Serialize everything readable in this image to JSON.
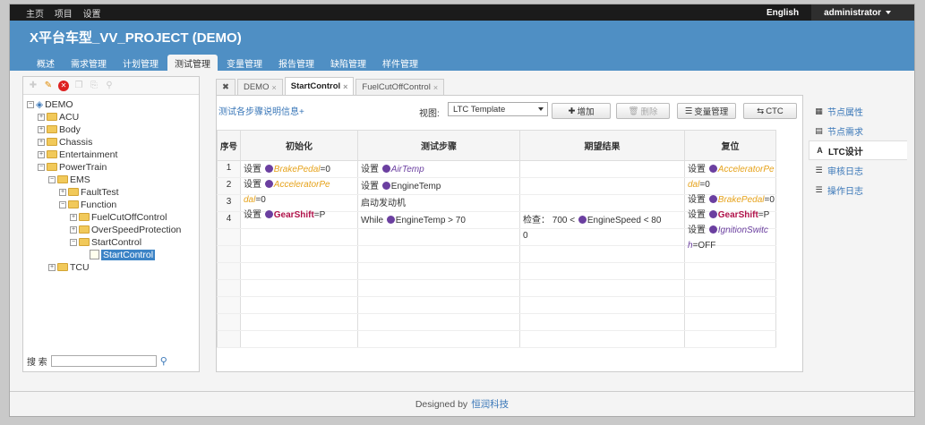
{
  "topbar": {
    "links": [
      "主页",
      "项目",
      "设置"
    ],
    "lang": "English",
    "user": "administrator"
  },
  "header": {
    "title": "X平台车型_VV_PROJECT (DEMO)"
  },
  "nav": [
    "概述",
    "需求管理",
    "计划管理",
    "测试管理",
    "变量管理",
    "报告管理",
    "缺陷管理",
    "样件管理"
  ],
  "nav_active": "测试管理",
  "tree": {
    "root": "DEMO",
    "nodes": [
      "ACU",
      "Body",
      "Chassis",
      "Entertainment",
      "PowerTrain",
      "EMS",
      "FaultTest",
      "Function",
      "FuelCutOffControl",
      "OverSpeedProtection",
      "StartControl",
      "StartControl",
      "TCU"
    ]
  },
  "search": {
    "label": "搜 索"
  },
  "tabs": [
    "DEMO",
    "StartControl",
    "FuelCutOffControl"
  ],
  "content": {
    "step_info_link": "测试各步骤说明信息+",
    "view_label": "视图:",
    "view_value": "LTC Template",
    "buttons": {
      "add": "增加",
      "delete": "删除",
      "var": "变量管理",
      "ctc": "CTC"
    }
  },
  "grid": {
    "headers": [
      "序号",
      "初始化",
      "测试步骤",
      "期望结果",
      "复位"
    ],
    "nums": [
      "1",
      "2",
      "3",
      "4"
    ],
    "init": {
      "set": "设置",
      "v1": "BrakePedal",
      "e1": "=0",
      "v2a": "AcceleratorPe",
      "v2b": "dal",
      "e2": "=0",
      "v3": "GearShift",
      "e3": "=P"
    },
    "steps": {
      "set": "设置",
      "s1": "AirTemp",
      "s2": "EngineTemp",
      "s3": "启动发动机",
      "s4a": "While ",
      "s4b": "EngineTemp > 70"
    },
    "expect": {
      "a": "检查： 700 < ",
      "b": "EngineSpeed < 80",
      "c": "0"
    },
    "reset": {
      "set": "设置",
      "v1a": "AcceleratorPe",
      "v1b": "dal",
      "e1": "=0",
      "v2": "BrakePedal",
      "e2": "=0",
      "v3": "GearShift",
      "e3": "=P",
      "v4a": "IgnitionSwitc",
      "v4b": "h",
      "e4": "=OFF"
    }
  },
  "right_menu": [
    "节点属性",
    "节点需求",
    "LTC设计",
    "审核日志",
    "操作日志"
  ],
  "right_active": "LTC设计",
  "footer": {
    "text": "Designed by",
    "brand": "恒润科技"
  },
  "colors": {
    "header_blue": "#4f8fc4",
    "var_yellow": "#e6a21a",
    "var_purple": "#6b3fa0",
    "var_red": "#b0124a"
  }
}
